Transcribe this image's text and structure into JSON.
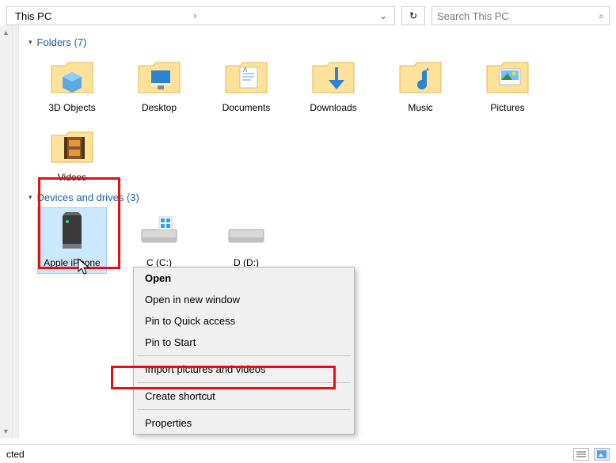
{
  "address": {
    "location": "This PC",
    "chevron_right": "›",
    "chevron_down": "⌄",
    "refresh": "↻"
  },
  "search": {
    "placeholder": "Search This PC",
    "icon": "⌕"
  },
  "groups": {
    "folders": {
      "label": "Folders (7)",
      "items": [
        {
          "label": "3D Objects"
        },
        {
          "label": "Desktop"
        },
        {
          "label": "Documents"
        },
        {
          "label": "Downloads"
        },
        {
          "label": "Music"
        },
        {
          "label": "Pictures"
        },
        {
          "label": "Videos"
        }
      ]
    },
    "devices": {
      "label": "Devices and drives (3)",
      "items": [
        {
          "label": "Apple iPhone",
          "selected": true
        },
        {
          "label": "C (C:)"
        },
        {
          "label": "D (D:)"
        }
      ]
    }
  },
  "context_menu": {
    "open": "Open",
    "open_new_window": "Open in new window",
    "pin_quick_access": "Pin to Quick access",
    "pin_start": "Pin to Start",
    "import": "Import pictures and videos",
    "create_shortcut": "Create shortcut",
    "properties": "Properties"
  },
  "status": {
    "text": "cted"
  }
}
